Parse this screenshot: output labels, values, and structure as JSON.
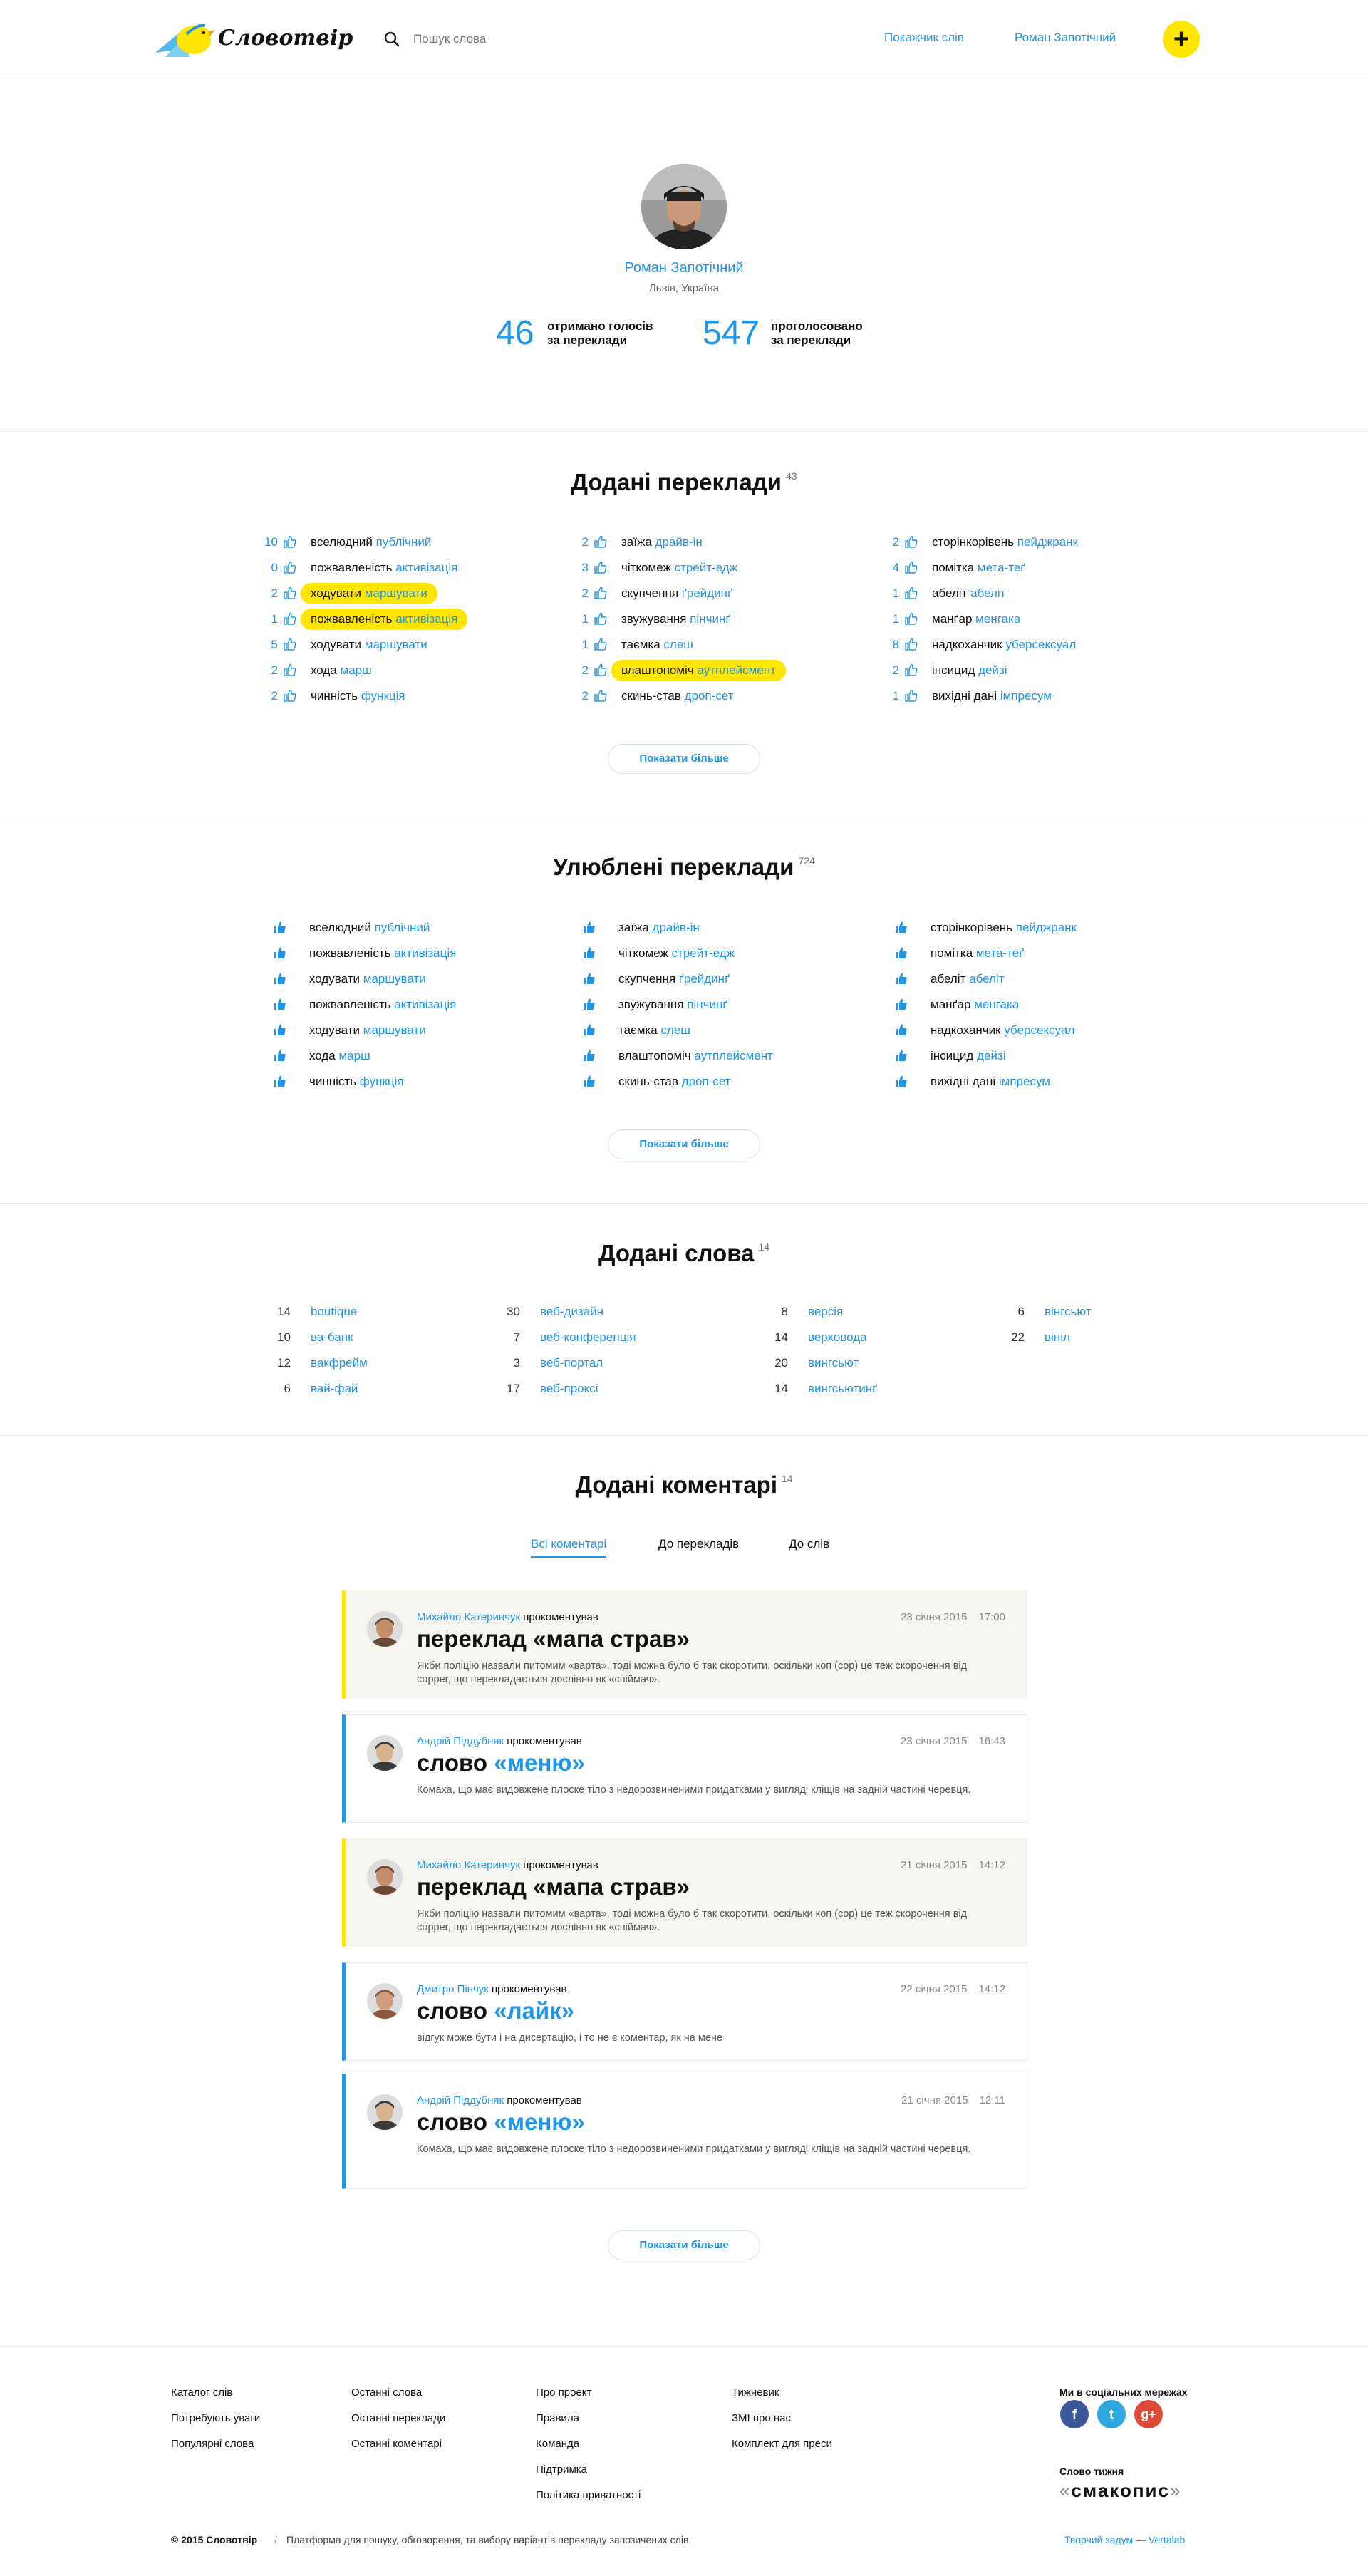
{
  "header": {
    "logo_text": "Словотвір",
    "search_placeholder": "Пошук слова",
    "nav_index": "Покажчик слів",
    "nav_user": "Роман Запотічний",
    "add_label": "+"
  },
  "profile": {
    "name": "Роман Запотічний",
    "location": "Львів, Україна",
    "stats": [
      {
        "value": "46",
        "label": "отримано голосів\nза переклади"
      },
      {
        "value": "547",
        "label": "проголосовано\nза переклади"
      }
    ]
  },
  "added_translations": {
    "title": "Додані переклади",
    "count": "43",
    "columns": [
      [
        {
          "votes": "10",
          "src": "вселюдний",
          "dst": "публічний",
          "hl": false
        },
        {
          "votes": "0",
          "src": "пожвавленість",
          "dst": "активізація",
          "hl": false
        },
        {
          "votes": "2",
          "src": "ходувати",
          "dst": "маршувати",
          "hl": true
        },
        {
          "votes": "1",
          "src": "пожвавленість",
          "dst": "активізація",
          "hl": true
        },
        {
          "votes": "5",
          "src": "ходувати",
          "dst": "маршувати",
          "hl": false
        },
        {
          "votes": "2",
          "src": "хода",
          "dst": "марш",
          "hl": false
        },
        {
          "votes": "2",
          "src": "чинність",
          "dst": "функція",
          "hl": false
        }
      ],
      [
        {
          "votes": "2",
          "src": "заїжа",
          "dst": "драйв-ін",
          "hl": false
        },
        {
          "votes": "3",
          "src": "чіткомеж",
          "dst": "стрейт-едж",
          "hl": false
        },
        {
          "votes": "2",
          "src": "скупчення",
          "dst": "ґрейдинґ",
          "hl": false
        },
        {
          "votes": "1",
          "src": "звужування",
          "dst": "пінчинґ",
          "hl": false
        },
        {
          "votes": "1",
          "src": "таємка",
          "dst": "слеш",
          "hl": false
        },
        {
          "votes": "2",
          "src": "влаштопоміч",
          "dst": "аутплейсмент",
          "hl": true
        },
        {
          "votes": "2",
          "src": "скинь-став",
          "dst": "дроп-сет",
          "hl": false
        }
      ],
      [
        {
          "votes": "2",
          "src": "сторінкорівень",
          "dst": "пейджранк",
          "hl": false
        },
        {
          "votes": "4",
          "src": "помітка",
          "dst": "мета-теґ",
          "hl": false
        },
        {
          "votes": "1",
          "src": "абеліт",
          "dst": "абеліт",
          "hl": false
        },
        {
          "votes": "1",
          "src": "манґар",
          "dst": "менгака",
          "hl": false
        },
        {
          "votes": "8",
          "src": "надкоханчик",
          "dst": "уберсексуал",
          "hl": false
        },
        {
          "votes": "2",
          "src": "інсицид",
          "dst": "дейзі",
          "hl": false
        },
        {
          "votes": "1",
          "src": "вихідні дані",
          "dst": "імпресум",
          "hl": false
        }
      ]
    ],
    "more": "Показати більше"
  },
  "favorite_translations": {
    "title": "Улюблені переклади",
    "count": "724",
    "columns": [
      [
        {
          "src": "вселюдний",
          "dst": "публічний"
        },
        {
          "src": "пожвавленість",
          "dst": "активізація"
        },
        {
          "src": "ходувати",
          "dst": "маршувати"
        },
        {
          "src": "пожвавленість",
          "dst": "активізація"
        },
        {
          "src": "ходувати",
          "dst": "маршувати"
        },
        {
          "src": "хода",
          "dst": "марш"
        },
        {
          "src": "чинність",
          "dst": "функція"
        }
      ],
      [
        {
          "src": "заїжа",
          "dst": "драйв-ін"
        },
        {
          "src": "чіткомеж",
          "dst": "стрейт-едж"
        },
        {
          "src": "скупчення",
          "dst": "ґрейдинґ"
        },
        {
          "src": "звужування",
          "dst": "пінчинґ"
        },
        {
          "src": "таємка",
          "dst": "слеш"
        },
        {
          "src": "влаштопоміч",
          "dst": "аутплейсмент"
        },
        {
          "src": "скинь-став",
          "dst": "дроп-сет"
        }
      ],
      [
        {
          "src": "сторінкорівень",
          "dst": "пейджранк"
        },
        {
          "src": "помітка",
          "dst": "мета-теґ"
        },
        {
          "src": "абеліт",
          "dst": "абеліт"
        },
        {
          "src": "манґар",
          "dst": "менгака"
        },
        {
          "src": "надкоханчик",
          "dst": "уберсексуал"
        },
        {
          "src": "інсицид",
          "dst": "дейзі"
        },
        {
          "src": "вихідні дані",
          "dst": "імпресум"
        }
      ]
    ],
    "more": "Показати більше"
  },
  "added_words": {
    "title": "Додані слова",
    "count": "14",
    "columns": [
      [
        {
          "n": "14",
          "w": "boutique"
        },
        {
          "n": "10",
          "w": "ва-банк"
        },
        {
          "n": "12",
          "w": "вакфрейм"
        },
        {
          "n": "6",
          "w": "вай-фай"
        }
      ],
      [
        {
          "n": "30",
          "w": "веб-дизайн"
        },
        {
          "n": "7",
          "w": "веб-конференція"
        },
        {
          "n": "3",
          "w": "веб-портал"
        },
        {
          "n": "17",
          "w": "веб-проксі"
        }
      ],
      [
        {
          "n": "8",
          "w": "версія"
        },
        {
          "n": "14",
          "w": "верховода"
        },
        {
          "n": "20",
          "w": "вингсьют"
        },
        {
          "n": "14",
          "w": "вингсьютинґ"
        }
      ],
      [
        {
          "n": "6",
          "w": "вінгсьют"
        },
        {
          "n": "22",
          "w": "вініл"
        }
      ]
    ]
  },
  "comments": {
    "title": "Додані коментарі",
    "count": "14",
    "tabs": [
      "Всі коментарі",
      "До перекладів",
      "До слів"
    ],
    "items": [
      {
        "author": "Михайло Катеринчук",
        "action": "прокоментував",
        "date": "23 січня 2015",
        "time": "17:00",
        "kind": "переклад",
        "target": "«мапа страв»",
        "text": "Якби поліцію назвали питомим «варта», тоді можна було б так скоротити, оскільки коп (cop) це теж скорочення від сорреr, що перекладається дослівно як «спіймач».",
        "color": "yellow"
      },
      {
        "author": "Андрій Піддубняк",
        "action": "прокоментував",
        "date": "23 січня 2015",
        "time": "16:43",
        "kind": "слово",
        "target": "«меню»",
        "text": "Комаха, що має видовжене плоске тіло з недорозвиненими придатками у вигляді кліщів на задній частині черевця.",
        "color": "blue"
      },
      {
        "author": "Михайло Катеринчук",
        "action": "прокоментував",
        "date": "21 січня 2015",
        "time": "14:12",
        "kind": "переклад",
        "target": "«мапа страв»",
        "text": "Якби поліцію назвали питомим «варта», тоді можна було б так скоротити, оскільки коп (cop) це теж скорочення від сорреr, що перекладається дослівно як «спіймач».",
        "color": "yellow"
      },
      {
        "author": "Дмитро Пінчук",
        "action": "прокоментував",
        "date": "22 січня 2015",
        "time": "14:12",
        "kind": "слово",
        "target": "«лайк»",
        "text": "відгук може бути і на дисертацію, і то не є коментар, як на мене",
        "color": "blue"
      },
      {
        "author": "Андрій Піддубняк",
        "action": "прокоментував",
        "date": "21 січня 2015",
        "time": "12:11",
        "kind": "слово",
        "target": "«меню»",
        "text": "Комаха, що має видовжене плоске тіло з недорозвиненими придатками у вигляді кліщів на задній частині черевця.",
        "color": "blue"
      }
    ],
    "more": "Показати більше"
  },
  "footer": {
    "col1": [
      "Каталог слів",
      "Потребують уваги",
      "Популярні слова"
    ],
    "col2": [
      "Останні слова",
      "Останні переклади",
      "Останні коментарі"
    ],
    "col3": [
      "Про проект",
      "Правила",
      "Команда",
      "Підтримка",
      "Політика приватності"
    ],
    "col4": [
      "Тижневик",
      "ЗМІ про нас",
      "Комплект для преси"
    ],
    "social_title": "Ми в соціальних мережах",
    "social": [
      {
        "glyph": "f",
        "color": "#3b5998",
        "icon": "facebook-icon"
      },
      {
        "glyph": "t",
        "color": "#2ea7e0",
        "icon": "twitter-icon"
      },
      {
        "glyph": "g+",
        "color": "#dc4a38",
        "icon": "google-plus-icon"
      }
    ],
    "word_of_week_title": "Слово тижня",
    "word_of_week": "смакопис",
    "copyright": "© 2015 Словотвір",
    "separator": "/",
    "tagline": "Платформа для пошуку, обговорення, та вибору варіантів перекладу запозичених слів.",
    "credit": "Творчий задум — Vertalab"
  }
}
